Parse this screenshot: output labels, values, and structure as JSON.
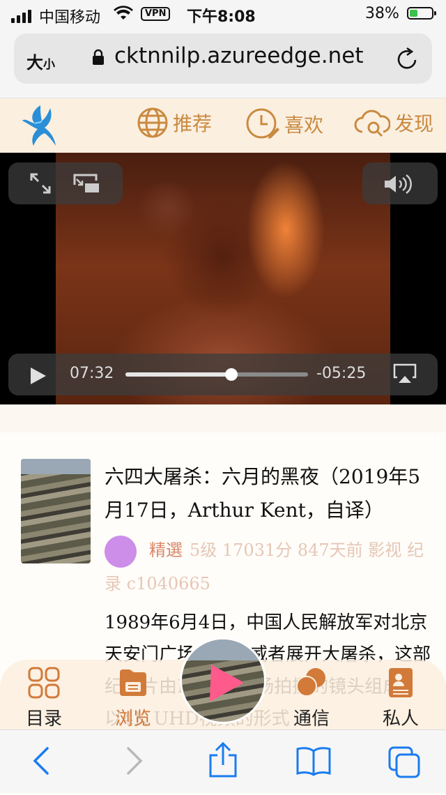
{
  "status_bar": {
    "carrier": "中国移动",
    "vpn": "VPN",
    "time": "下午8:08",
    "battery_pct": "38%",
    "battery_level": 0.38,
    "battery_color": "#3bc24a"
  },
  "address_bar": {
    "text_size_big": "大",
    "text_size_small": "小",
    "url": "cktnnilp.azureedge.net",
    "icons": [
      "lock-icon",
      "reload-icon"
    ]
  },
  "site_nav": {
    "items": [
      {
        "label": "推荐",
        "icon": "globe-icon"
      },
      {
        "label": "喜欢",
        "icon": "clock-pencil-icon"
      },
      {
        "label": "发现",
        "icon": "cloud-search-icon"
      }
    ],
    "accent": "#c98a40",
    "logo": "phoenix-logo"
  },
  "video_player": {
    "elapsed": "07:32",
    "remaining": "-05:25",
    "progress": 0.58,
    "controls": [
      "fullscreen-icon",
      "picture-in-picture-icon",
      "volume-icon",
      "play-icon",
      "airplay-icon"
    ]
  },
  "article": {
    "title": "六四大屠杀：六月的黑夜（2019年5月17日，Arthur Kent，自译）",
    "tag": "精選",
    "meta_text": "5级 17031分 847天前 影视 纪录 c1040665",
    "avatar_color": "#cc8ee8",
    "body": "1989年6月4日，中国人民解放军对北京天安门广场上的示威者展开大屠杀，这部纪录片由Kent在现场拍摄的镜头组成，以4K UHD视频的形式"
  },
  "tab_bar": {
    "tabs": [
      {
        "label": "目录",
        "icon": "grid-icon",
        "active": false
      },
      {
        "label": "浏览",
        "icon": "save-icon",
        "active": true
      },
      {
        "label": "通信",
        "icon": "chat-bubbles-icon",
        "active": false
      },
      {
        "label": "私人",
        "icon": "contact-card-icon",
        "active": false
      }
    ],
    "center": "play-button"
  },
  "browser_toolbar": {
    "buttons": [
      "back-icon",
      "forward-icon",
      "share-icon",
      "bookmarks-icon",
      "tabs-icon"
    ],
    "accent": "#1a7cf0"
  }
}
